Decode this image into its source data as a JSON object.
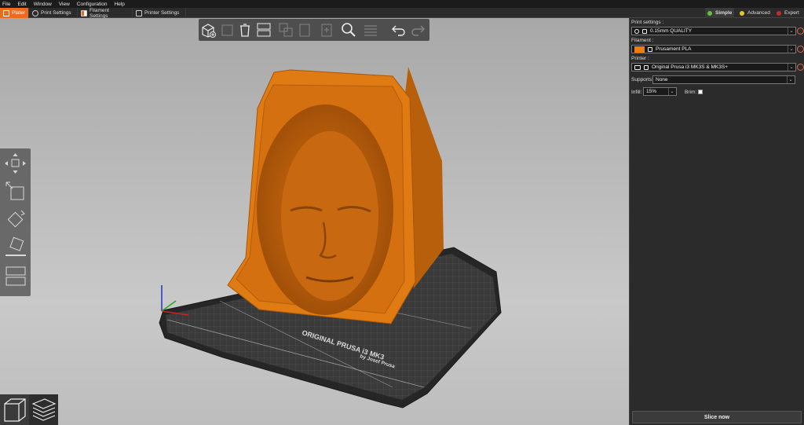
{
  "menu": [
    "File",
    "Edit",
    "Window",
    "View",
    "Configuration",
    "Help"
  ],
  "tabs": [
    {
      "label": "Plater",
      "active": true,
      "icon": "plater-icon"
    },
    {
      "label": "Print Settings",
      "active": false,
      "icon": "print-settings-icon"
    },
    {
      "label": "Filament Settings",
      "active": false,
      "icon": "filament-icon"
    },
    {
      "label": "Printer Settings",
      "active": false,
      "icon": "printer-icon"
    }
  ],
  "modes": [
    {
      "label": "Simple",
      "color": "#6abf3a",
      "active": true
    },
    {
      "label": "Advanced",
      "color": "#e3c823",
      "active": false
    },
    {
      "label": "Expert",
      "color": "#c42a2a",
      "active": false
    }
  ],
  "colors": {
    "accent": "#ed6b21",
    "model": "#e07b14",
    "bed": "#2e2e2e"
  },
  "bed_text": {
    "line1": "ORIGINAL PRUSA i3 MK3",
    "line2": "by Josef Prusa"
  },
  "sidebar": {
    "print_settings_label": "Print settings :",
    "print_settings_value": "0.15mm QUALITY",
    "filament_label": "Filament :",
    "filament_value": "Prusament PLA",
    "filament_color": "#ed7d12",
    "printer_label": "Printer :",
    "printer_value": "Original Prusa i3 MK3S & MK3S+",
    "supports_label": "Supports:",
    "supports_value": "None",
    "infill_label": "Infill:",
    "infill_value": "15%",
    "brim_label": "Brim:",
    "slice_label": "Slice now"
  }
}
